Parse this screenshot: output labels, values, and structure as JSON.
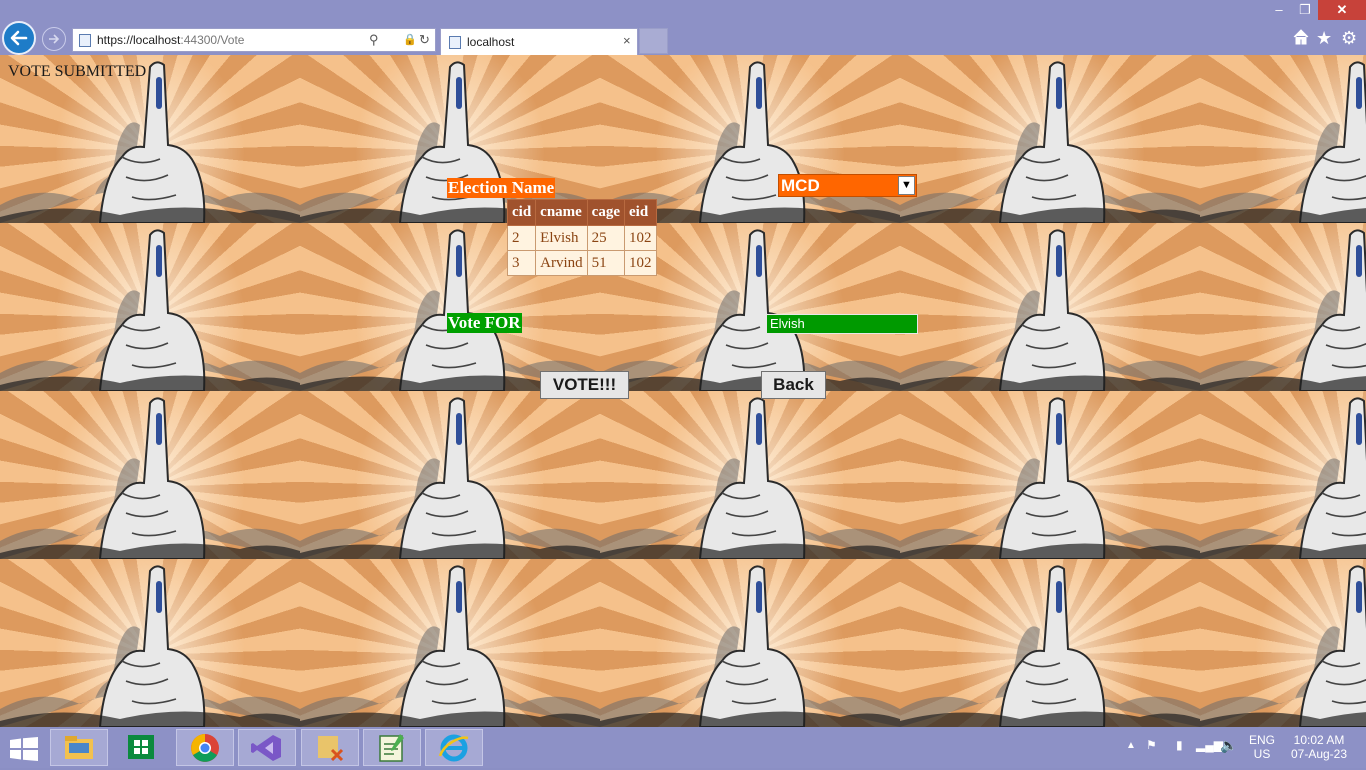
{
  "window": {
    "minimize_icon": "minimize-icon",
    "maximize_icon": "restore-icon",
    "close_icon": "close-icon"
  },
  "browser": {
    "url_prefix": "https://localhost",
    "url_port_path": ":44300/Vote",
    "tab_title": "localhost",
    "tab_close": "×",
    "toolbar_icons": [
      "home-icon",
      "star-icon",
      "gear-icon"
    ]
  },
  "page": {
    "status": "VOTE SUBMITTED",
    "election_label": "Election Name",
    "election_selected": "MCD",
    "table": {
      "columns": [
        "cid",
        "cname",
        "cage",
        "eid"
      ],
      "rows": [
        [
          "2",
          "Elvish",
          "25",
          "102"
        ],
        [
          "3",
          "Arvind",
          "51",
          "102"
        ]
      ]
    },
    "vote_for_label": "Vote FOR",
    "vote_for_value": "Elvish",
    "vote_button": "VOTE!!!",
    "back_button": "Back"
  },
  "taskbar": {
    "apps": [
      "file-explorer",
      "store",
      "chrome",
      "visual-studio",
      "app-5",
      "notepad-app",
      "internet-explorer"
    ],
    "language": "ENG",
    "region": "US",
    "time": "10:02 AM",
    "date": "07-Aug-23"
  },
  "colors": {
    "election_bg": "#ff6600",
    "vote_for_bg": "#00a000",
    "table_header": "#a0522d",
    "table_cell": "#fff3e0",
    "chrome": "#8d91c6"
  }
}
